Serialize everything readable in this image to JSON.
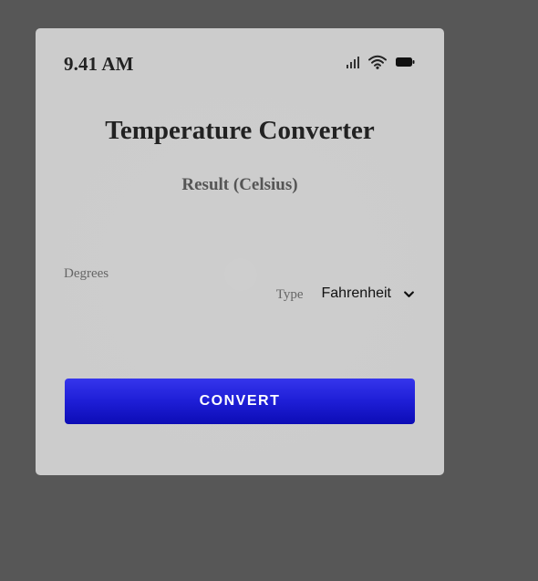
{
  "status_bar": {
    "time": "9.41 AM",
    "icons": [
      "signal-icon",
      "wifi-icon",
      "battery-icon"
    ]
  },
  "app": {
    "title": "Temperature Converter",
    "result_label": "Result (Celsius)",
    "degrees_label": "Degrees",
    "type_label": "Type",
    "type_selected": "Fahrenheit",
    "convert_label": "CONVERT"
  },
  "colors": {
    "background": "#575757",
    "card": "#cccccc",
    "button": "#1e1ed6",
    "button_text": "#ffffff"
  }
}
